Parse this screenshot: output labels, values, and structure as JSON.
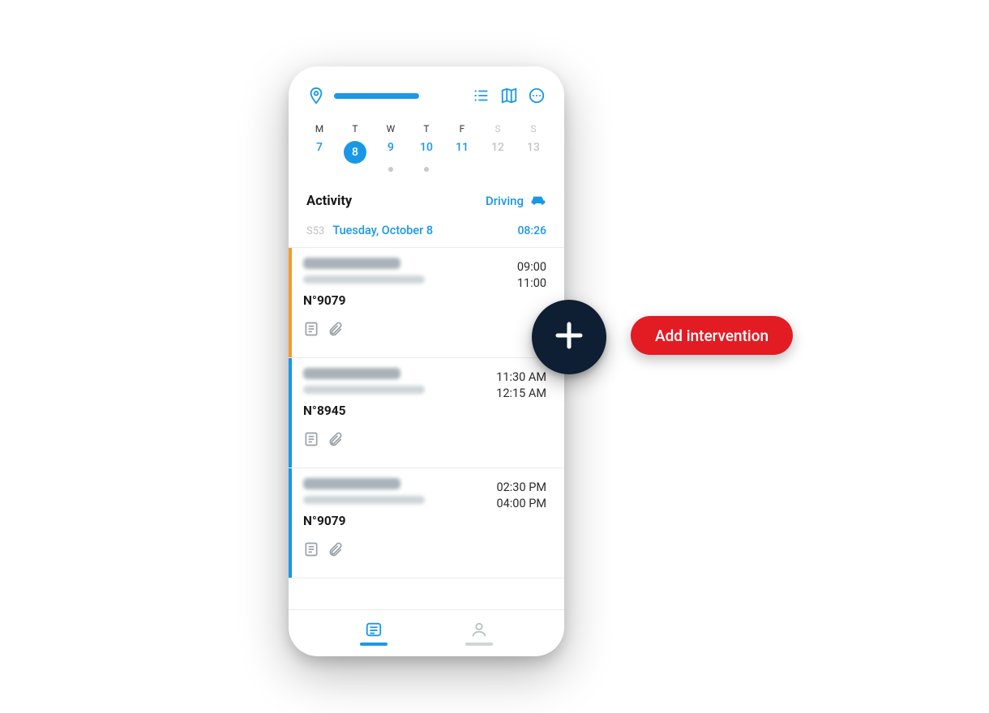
{
  "colors": {
    "accent": "#1a98e6",
    "dark": "#0e1e33",
    "red": "#e31b23",
    "orange": "#f59a2e"
  },
  "topbar": {
    "location_icon": "location-pin",
    "list_icon": "list-view",
    "map_icon": "map",
    "more_icon": "more"
  },
  "week": {
    "days": [
      {
        "letter": "M",
        "num": "7",
        "selected": false,
        "dot": false,
        "muted": false
      },
      {
        "letter": "T",
        "num": "8",
        "selected": true,
        "dot": false,
        "muted": false
      },
      {
        "letter": "W",
        "num": "9",
        "selected": false,
        "dot": true,
        "muted": false
      },
      {
        "letter": "T",
        "num": "10",
        "selected": false,
        "dot": true,
        "muted": false
      },
      {
        "letter": "F",
        "num": "11",
        "selected": false,
        "dot": false,
        "muted": false
      },
      {
        "letter": "S",
        "num": "12",
        "selected": false,
        "dot": false,
        "muted": true
      },
      {
        "letter": "S",
        "num": "13",
        "selected": false,
        "dot": false,
        "muted": true
      }
    ]
  },
  "activity": {
    "title": "Activity",
    "status_label": "Driving",
    "status_icon": "car"
  },
  "dateline": {
    "week_code": "S53",
    "date_text": "Tuesday, October 8",
    "time": "08:26"
  },
  "cards": [
    {
      "stripe": "orange",
      "title_redacted": true,
      "job_no": "N°9079",
      "start": "09:00",
      "end": "11:00"
    },
    {
      "stripe": "blue",
      "title_redacted": true,
      "job_no": "N°8945",
      "start": "11:30 AM",
      "end": "12:15 AM"
    },
    {
      "stripe": "blue",
      "title_redacted": true,
      "job_no": "N°9079",
      "start": "02:30 PM",
      "end": "04:00 PM"
    }
  ],
  "bottomnav": {
    "tab1_icon": "list",
    "tab2_icon": "user",
    "active_index": 0
  },
  "fab": {
    "icon": "plus",
    "pill_label": "Add intervention"
  }
}
